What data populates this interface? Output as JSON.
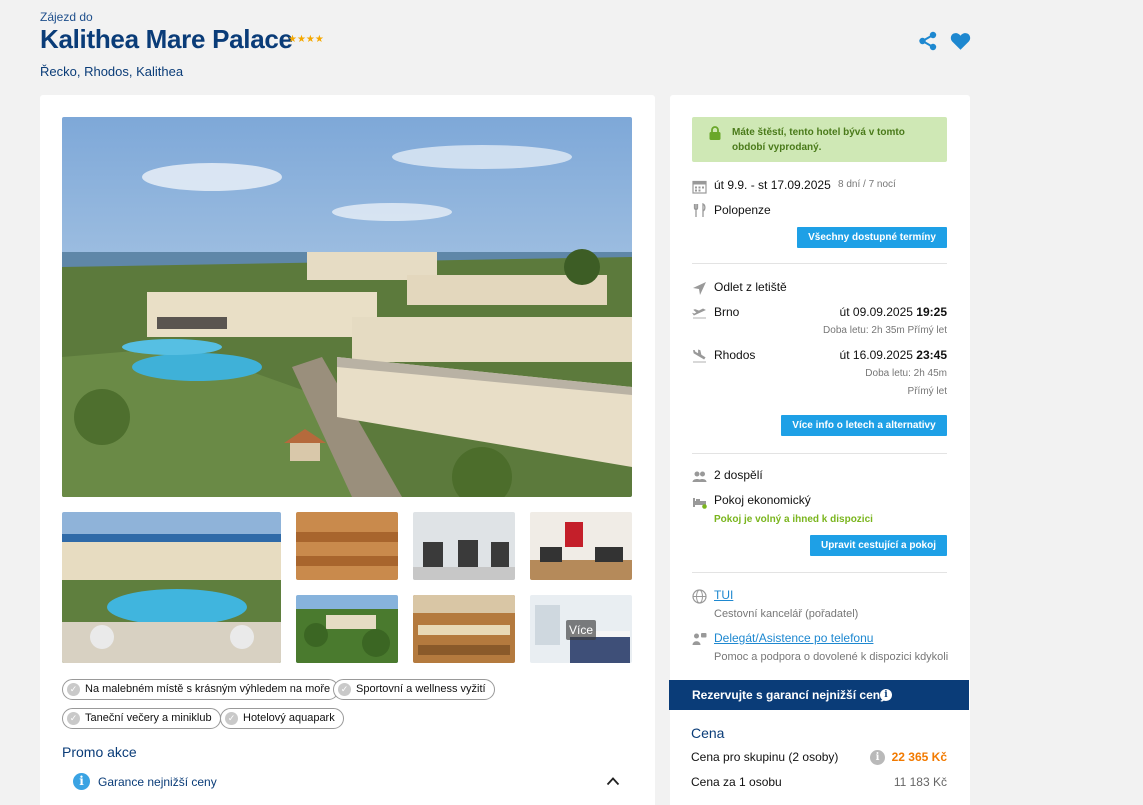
{
  "header": {
    "subtitle": "Zájezd do",
    "title": "Kalithea Mare Palace",
    "stars": "★★★★",
    "location": "Řecko, Rhodos, Kalithea"
  },
  "gallery": {
    "more_label": "Více"
  },
  "features": [
    "Na malebném místě s krásným výhledem na moře",
    "Sportovní a wellness vyžití",
    "Taneční večery a miniklub",
    "Hotelový aquapark"
  ],
  "promo": {
    "heading": "Promo akce",
    "item": "Garance nejnižší ceny"
  },
  "booking": {
    "lucky_text": "Máte štěstí, tento hotel bývá v tomto období vyprodaný.",
    "dates": "út 9.9. - st 17.09.2025",
    "duration": "8 dní / 7 nocí",
    "board": "Polopenze",
    "all_dates_button": "Všechny dostupné termíny",
    "departure_label": "Odlet z letiště",
    "outbound": {
      "from": "Brno",
      "date": "út 09.09.2025",
      "time": "19:25",
      "info": "Doba letu: 2h 35m",
      "type": "Přímý let"
    },
    "inbound": {
      "from": "Rhodos",
      "date": "út 16.09.2025",
      "time": "23:45",
      "info": "Doba letu: 2h 45m",
      "type": "Přímý let"
    },
    "flights_button": "Více info o letech a alternativy",
    "travelers": "2 dospělí",
    "room": "Pokoj ekonomický",
    "room_status": "Pokoj je volný a ihned k dispozici",
    "edit_button": "Upravit cestující a pokoj",
    "operator": "TUI",
    "operator_desc": "Cestovní kancelář (pořadatel)",
    "delegate": "Delegát/Asistence po telefonu",
    "delegate_desc": "Pomoc a podpora o dovolené k dispozici kdykoli",
    "guarantee": "Rezervujte s garancí nejnižší ceny!",
    "price_heading": "Cena",
    "group_price_label": "Cena pro skupinu (2 osoby)",
    "group_price": "22 365 Kč",
    "person_price_label": "Cena za 1 osobu",
    "person_price": "11 183 Kč"
  },
  "colors": {
    "brand_navy": "#0a3c78",
    "accent_blue": "#1ea0e6",
    "price_orange": "#f27a00",
    "success_green": "#7ab51d"
  }
}
